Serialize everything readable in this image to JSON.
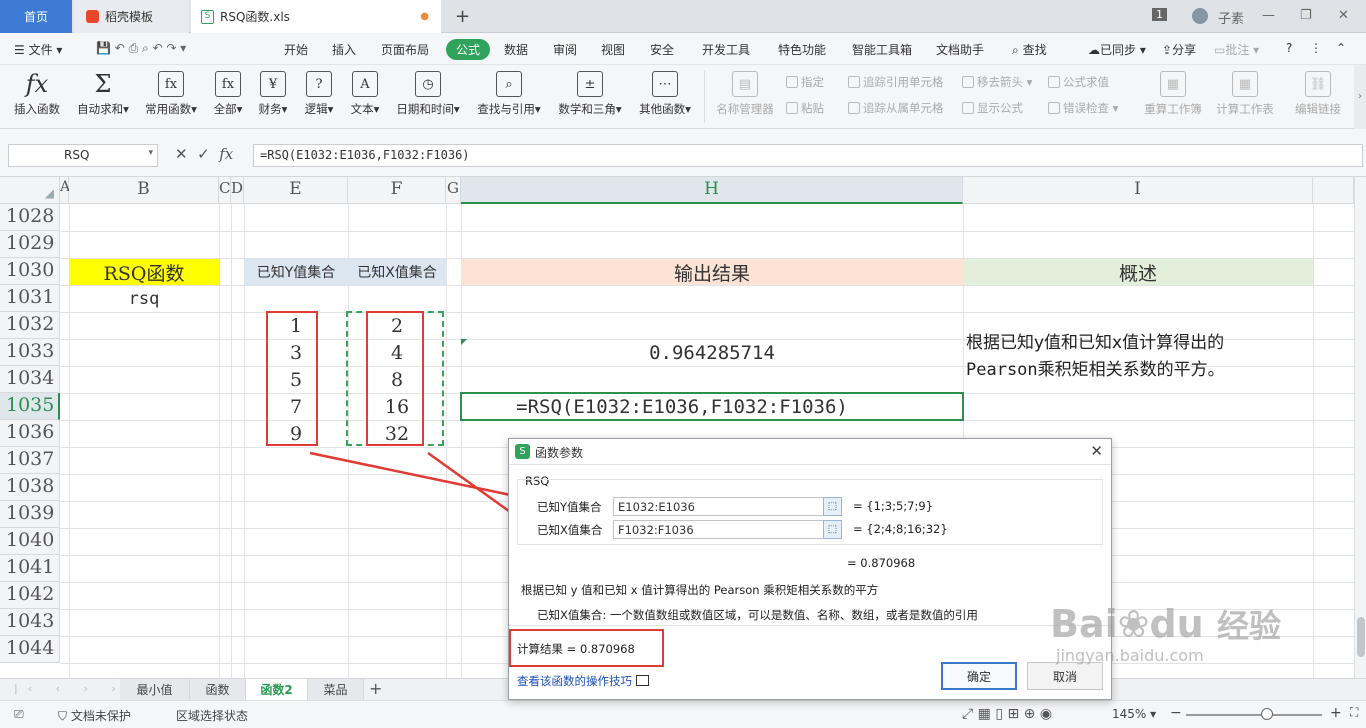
{
  "titlebar": {
    "home_tab": "首页",
    "doc_tab": "稻壳模板",
    "active_tab": "RSQ函数.xls",
    "badge": "1",
    "user": "子素"
  },
  "menubar": {
    "file": "文件",
    "items": [
      "开始",
      "插入",
      "页面布局",
      "公式",
      "数据",
      "审阅",
      "视图",
      "安全",
      "开发工具",
      "特色功能",
      "智能工具箱",
      "文档助手"
    ],
    "search": "查找",
    "synced": "已同步",
    "share": "分享",
    "comment": "批注"
  },
  "ribbon": {
    "insert_fn": "插入函数",
    "autosum": "自动求和",
    "common_fn": "常用函数",
    "all": "全部",
    "finance": "财务",
    "logic": "逻辑",
    "text": "文本",
    "datetime": "日期和时间",
    "lookup": "查找与引用",
    "math": "数学和三角",
    "other_fn": "其他函数",
    "name_mgr": "名称管理器",
    "specify": "指定",
    "paste": "粘贴",
    "trace_precedents": "追踪引用单元格",
    "trace_dependents": "追踪从属单元格",
    "remove_arrows": "移去箭头",
    "show_formula": "显示公式",
    "eval_formula": "公式求值",
    "error_check": "错误检查",
    "recalc_book": "重算工作簿",
    "calc_sheet": "计算工作表",
    "edit_links": "编辑链接"
  },
  "formula_bar": {
    "name_box": "RSQ",
    "formula": "=RSQ(E1032:E1036,F1032:F1036)"
  },
  "grid": {
    "columns": [
      "A",
      "B",
      "C",
      "D",
      "E",
      "F",
      "G",
      "H",
      "I"
    ],
    "rows": [
      "1028",
      "1029",
      "1030",
      "1031",
      "1032",
      "1033",
      "1034",
      "1035",
      "1036",
      "1037",
      "1038",
      "1039",
      "1040",
      "1041",
      "1042",
      "1043",
      "1044"
    ],
    "title_cell": "RSQ函数",
    "subtitle_cell": "rsq",
    "header_y": "已知Y值集合",
    "header_x": "已知X值集合",
    "header_output": "输出结果",
    "header_desc": "概述",
    "y_values": [
      "1",
      "3",
      "5",
      "7",
      "9"
    ],
    "x_values": [
      "2",
      "4",
      "8",
      "16",
      "32"
    ],
    "result": "0.964285714",
    "formula_cell": "=RSQ(E1032:E1036,F1032:F1036)",
    "desc_line1": "根据已知y值和已知x值计算得出的",
    "desc_line2": "Pearson乘积矩相关系数的平方。"
  },
  "sheet_tabs": [
    "最小值",
    "函数",
    "函数2",
    "菜品"
  ],
  "statusbar": {
    "protect": "文档未保护",
    "selection_state": "区域选择状态",
    "zoom": "145%"
  },
  "dialog": {
    "title": "函数参数",
    "fn_name": "RSQ",
    "arg1_label": "已知Y值集合",
    "arg1_value": "E1032:E1036",
    "arg1_result": "=  {1;3;5;7;9}",
    "arg2_label": "已知X值集合",
    "arg2_value": "F1032:F1036",
    "arg2_result": "=  {2;4;8;16;32}",
    "formula_result": "=  0.870968",
    "description": "根据已知 y 值和已知 x 值计算得出的 Pearson 乘积矩相关系数的平方",
    "arg_help": "已知X值集合:  一个数值数组或数值区域，可以是数值、名称、数组，或者是数值的引用",
    "calc_result": "计算结果  =  0.870968",
    "help_link": "查看该函数的操作技巧",
    "ok": "确定",
    "cancel": "取消"
  },
  "watermark": {
    "brand": "Bai",
    "brand2": "du",
    "brand_cn": "经验",
    "url": "jingyan.baidu.com"
  },
  "colors": {
    "accent": "#2fa35c",
    "highlight_yellow": "#ffff00",
    "header_blue": "#dce6f1",
    "header_peach": "#fbe4d6",
    "header_green": "#e2efda",
    "annotation_red": "#e03b35"
  }
}
